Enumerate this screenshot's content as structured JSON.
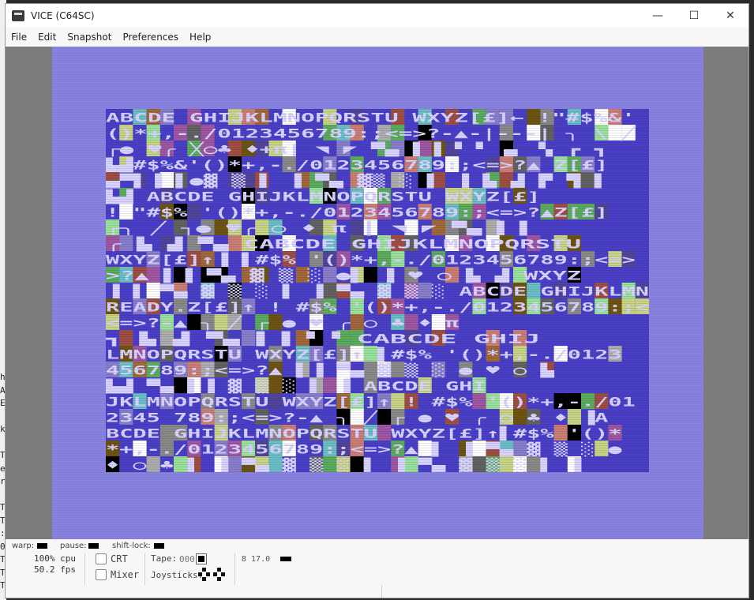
{
  "window": {
    "title": "VICE (C64SC)",
    "controls": {
      "minimize": "—",
      "maximize": "☐",
      "close": "✕"
    }
  },
  "menu": [
    "File",
    "Edit",
    "Snapshot",
    "Preferences",
    "Help"
  ],
  "background_glyphs": [
    "h",
    "A",
    "E",
    "",
    "k",
    "",
    "T",
    "e",
    "r",
    "",
    "T",
    "T",
    ":",
    "0",
    "T",
    "T",
    "T"
  ],
  "c64": {
    "border_color": "#8882e0",
    "screen_color": "#4a40c8",
    "screen_rows": [
      "ABCDE GHIJKLMNOPQRSTU WXYZ[£]←  !\"#$%&'",
      "()*+,-./0123456789:;<=>?-▲-|---|  ╮ \\ ╱",
      "┌●  ♥╭ ╳○♣ ♦+π| ◥ ◤ ▀▄ ▌▐ ▘▝ ▗▖ ▚ ┏ ┓",
      "▙▟#$%&'()*+,-./0123456789:;<=>?▲ Z[£]",
      "▄▀▌▐ ▌●▓ ▒ ▌ ▐ ▀▄ ▓▒ ░  ▌ ▐ ▙ ▟ ▛ ▜ ▌",
      "▙▟ ABCDE GHIJKLMNOPQRSTU WXYZ[£]",
      "! \"#$% '()*+,-./0123456789:;<=>?▲Z[£]",
      " ┌╮  ╱ ┐● ♥╭ ○ ♦ π  ┃ ◥ ◤ ▀▄ ▌▐",
      "  ╭  ▙ ▟  ▀▄ CABCDE GHIJKLMNOPQRSTU",
      "WXYZ[£]↑▐ ▌#$% '()*+,-./0123456789:;<=>",
      ">?▲  ▌▐ ▀▄ ▓ ▒ ░  ●▌ ▐ ♥ ○ ▙ ▟ WXYZ",
      "▐ ▌ ▀▄ ▓ ▒ ░ ▌ ▐ ▀▄ ▓ ▒ ░ ABCDE GHIJKLMNOPQRS",
      "READY.Z[£]↑ ! #$% '()*+,-./0123456789:;<",
      "<=>?-▲ ╮ ╱ ┌ ● ♥ ╭ ○ ♣ ♦ π",
      "  ┓  ▙ ▟  ▀▄ ▌▐  ▘▝  CABCDE GHIJ",
      "LMNOPQRSTU WXYZ[£]↑ ▌#$% '()*+,-./0123",
      "456789:;<=>?▲ ▌▐ ▀▄ ▓ ▒ ░ ● ♥ ○ ▙",
      "▙▟ ▀▄ ▌▐ ▓ ▒ ░ ▌ ▐ ABCDE GHI",
      "JKLMNOPQRSTU WXYZ[£]↑ ! #$% '()*+,-./01",
      "2345 789:;<=>?-▲ ╮ ╱ ┌ ● ♥ ╭ ○ ♣ ♦ ▐A",
      "BCDE GHIJKLMNOPQRSTU WXYZ[£]↑▌#$% '()*",
      "*+,-./0123456789:;<=>?▲ ▌ ▐ ▀▄ ▓ ▒ ░ ●",
      "♦ ○ ♣ ▌ ▐ ▀▄ ▓ ▒ ░ ▌ ▐ ▀▄ ▓ ▒ ░ ▌ ▐"
    ],
    "palette": [
      "#ffffff",
      "#000000",
      "#9f4e44",
      "#6abfc6",
      "#a057a3",
      "#5cab5e",
      "#50459b",
      "#c9d487",
      "#a1683c",
      "#6d5412",
      "#cb7e75",
      "#626262",
      "#898989",
      "#9ae29b",
      "#887ecb",
      "#adadad"
    ]
  },
  "status": {
    "warp_label": "warp:",
    "pause_label": "pause:",
    "shiftlock_label": "shift-lock:",
    "cpu": "100% cpu",
    "fps": "50.2 fps",
    "crt_label": "CRT",
    "mixer_label": "Mixer",
    "tape_label": "Tape:",
    "tape_counter": "000",
    "joysticks_label": "Joysticks:",
    "drive_info": "8 17.0"
  }
}
